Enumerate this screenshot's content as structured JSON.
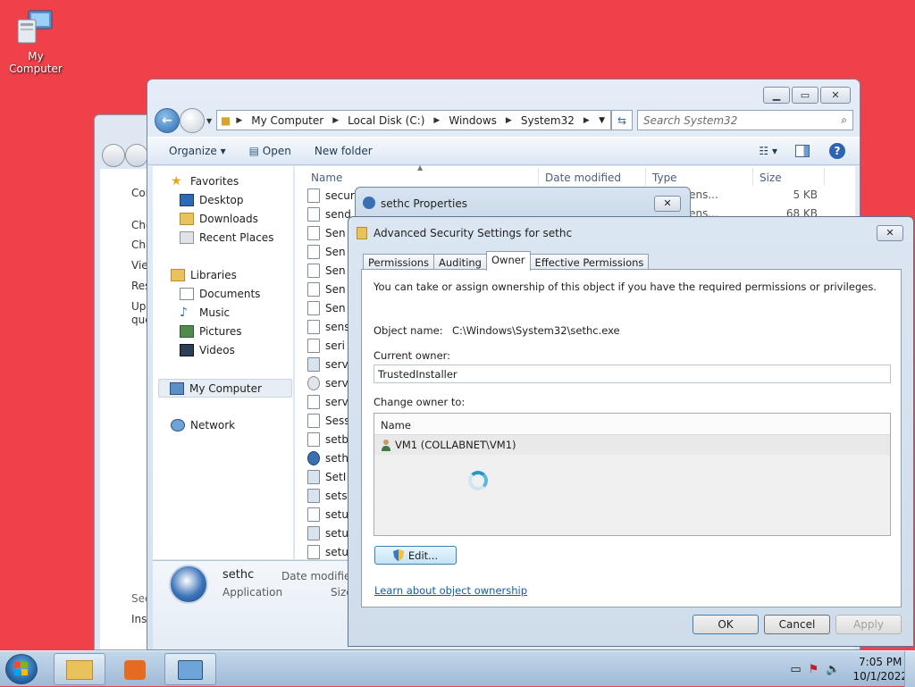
{
  "desktop": {
    "icon_label": "My Computer"
  },
  "bg_window": {
    "lines": [
      "Con",
      "Che",
      "Cha",
      "View",
      "Rest",
      "Upd",
      "ques",
      "See",
      "Installed Updates"
    ]
  },
  "explorer": {
    "breadcrumb": [
      "My Computer",
      "Local Disk (C:)",
      "Windows",
      "System32"
    ],
    "search_placeholder": "Search System32",
    "toolbar": {
      "organize": "Organize",
      "open": "Open",
      "new_folder": "New folder"
    },
    "nav": {
      "favorites": "Favorites",
      "desktop": "Desktop",
      "downloads": "Downloads",
      "recent": "Recent Places",
      "libraries": "Libraries",
      "documents": "Documents",
      "music": "Music",
      "pictures": "Pictures",
      "videos": "Videos",
      "computer": "My Computer",
      "network": "Network"
    },
    "columns": {
      "name": "Name",
      "date": "Date modified",
      "type": "Type",
      "size": "Size"
    },
    "files": [
      "secur",
      "send",
      "Sen",
      "Sen",
      "Sen",
      "Sen",
      "Sen",
      "sens",
      "seri",
      "serv",
      "serv",
      "serv",
      "Sess",
      "setb",
      "seth",
      "SetI",
      "sets",
      "setu",
      "setu",
      "setu"
    ],
    "visible_types": [
      "ion extens...",
      "ion extens..."
    ],
    "visible_sizes": [
      "5 KB",
      "68 KB"
    ],
    "details": {
      "name": "sethc",
      "kind": "Application",
      "date_label": "Date modified",
      "size_label": "Size"
    }
  },
  "props_dialog": {
    "title": "sethc Properties"
  },
  "adv_dialog": {
    "title": "Advanced Security Settings for sethc",
    "tabs": [
      "Permissions",
      "Auditing",
      "Owner",
      "Effective Permissions"
    ],
    "intro": "You can take or assign ownership of this object if you have the required permissions or privileges.",
    "object_name_label": "Object name:",
    "object_name_value": "C:\\Windows\\System32\\sethc.exe",
    "current_owner_label": "Current owner:",
    "current_owner_value": "TrustedInstaller",
    "change_owner_label": "Change owner to:",
    "list_header": "Name",
    "list_rows": [
      "VM1 (COLLABNET\\VM1)"
    ],
    "edit_button": "Edit...",
    "learn_link": "Learn about object ownership",
    "ok": "OK",
    "cancel": "Cancel",
    "apply": "Apply"
  },
  "taskbar": {
    "time": "7:05 PM",
    "date": "10/1/2022"
  }
}
